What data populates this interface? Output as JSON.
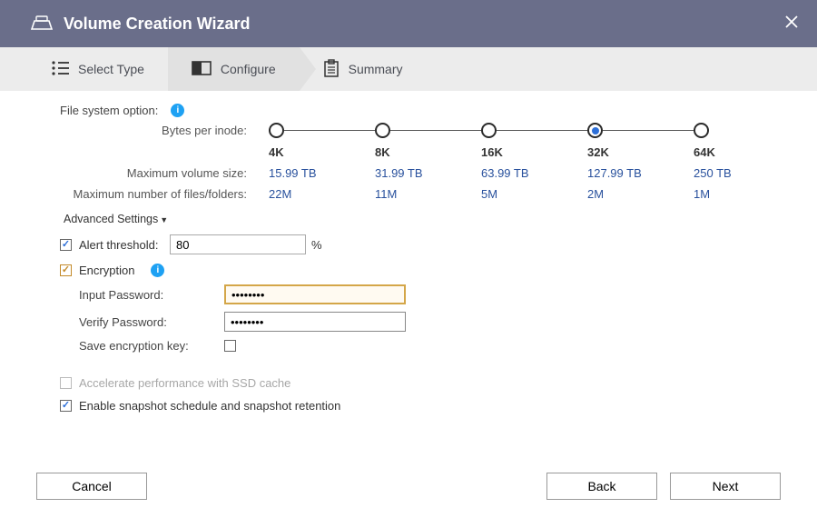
{
  "window": {
    "title": "Volume Creation Wizard"
  },
  "steps": {
    "select_type": "Select Type",
    "configure": "Configure",
    "summary": "Summary"
  },
  "filesystem": {
    "label": "File system option:",
    "bytes_per_inode_label": "Bytes per inode:",
    "max_volume_size_label": "Maximum volume size:",
    "max_files_label": "Maximum number of files/folders:",
    "options": [
      {
        "inode": "4K",
        "max_volume": "15.99 TB",
        "max_files": "22M"
      },
      {
        "inode": "8K",
        "max_volume": "31.99 TB",
        "max_files": "11M"
      },
      {
        "inode": "16K",
        "max_volume": "63.99 TB",
        "max_files": "5M"
      },
      {
        "inode": "32K",
        "max_volume": "127.99 TB",
        "max_files": "2M"
      },
      {
        "inode": "64K",
        "max_volume": "250 TB",
        "max_files": "1M"
      }
    ],
    "selected_index": 3
  },
  "advanced": {
    "heading": "Advanced Settings",
    "alert_threshold_label": "Alert threshold:",
    "alert_threshold_value": "80",
    "alert_threshold_unit": "%",
    "alert_threshold_checked": true,
    "encryption_label": "Encryption",
    "encryption_checked": true,
    "input_password_label": "Input Password:",
    "input_password_value": "••••••••",
    "verify_password_label": "Verify Password:",
    "verify_password_value": "••••••••",
    "save_key_label": "Save encryption key:",
    "save_key_checked": false
  },
  "extras": {
    "ssd_cache_label": "Accelerate performance with SSD cache",
    "ssd_cache_checked": false,
    "ssd_cache_enabled": false,
    "snapshot_label": "Enable snapshot schedule and snapshot retention",
    "snapshot_checked": true
  },
  "footer": {
    "cancel": "Cancel",
    "back": "Back",
    "next": "Next"
  }
}
